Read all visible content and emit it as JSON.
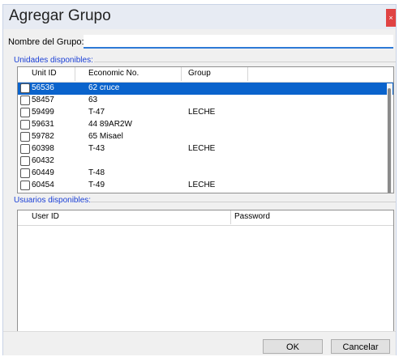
{
  "window": {
    "title": "Agregar Grupo",
    "close_glyph": "×"
  },
  "group_name": {
    "label": "Nombre del Grupo:",
    "value": ""
  },
  "units": {
    "section_label": "Unidades disponibles:",
    "columns": [
      "Unit ID",
      "Economic No.",
      "Group"
    ],
    "rows": [
      {
        "unit_id": "56536",
        "economic_no": "62 cruce",
        "group": "",
        "selected": true
      },
      {
        "unit_id": "58457",
        "economic_no": "63",
        "group": "",
        "selected": false
      },
      {
        "unit_id": "59499",
        "economic_no": "T-47",
        "group": "LECHE",
        "selected": false
      },
      {
        "unit_id": "59631",
        "economic_no": "44 89AR2W",
        "group": "",
        "selected": false
      },
      {
        "unit_id": "59782",
        "economic_no": "65 Misael",
        "group": "",
        "selected": false
      },
      {
        "unit_id": "60398",
        "economic_no": "T-43",
        "group": "LECHE",
        "selected": false
      },
      {
        "unit_id": "60432",
        "economic_no": "",
        "group": "",
        "selected": false
      },
      {
        "unit_id": "60449",
        "economic_no": "T-48",
        "group": "",
        "selected": false
      },
      {
        "unit_id": "60454",
        "economic_no": "T-49",
        "group": "LECHE",
        "selected": false
      }
    ]
  },
  "users": {
    "section_label": "Usuarios disponibles:",
    "columns": [
      "User ID",
      "Password"
    ]
  },
  "buttons": {
    "ok": "OK",
    "cancel": "Cancelar"
  },
  "colors": {
    "selection": "#0a63cc",
    "section_label": "#1a3fd6",
    "close": "#e04343",
    "input_underline": "#2d7ad6"
  }
}
